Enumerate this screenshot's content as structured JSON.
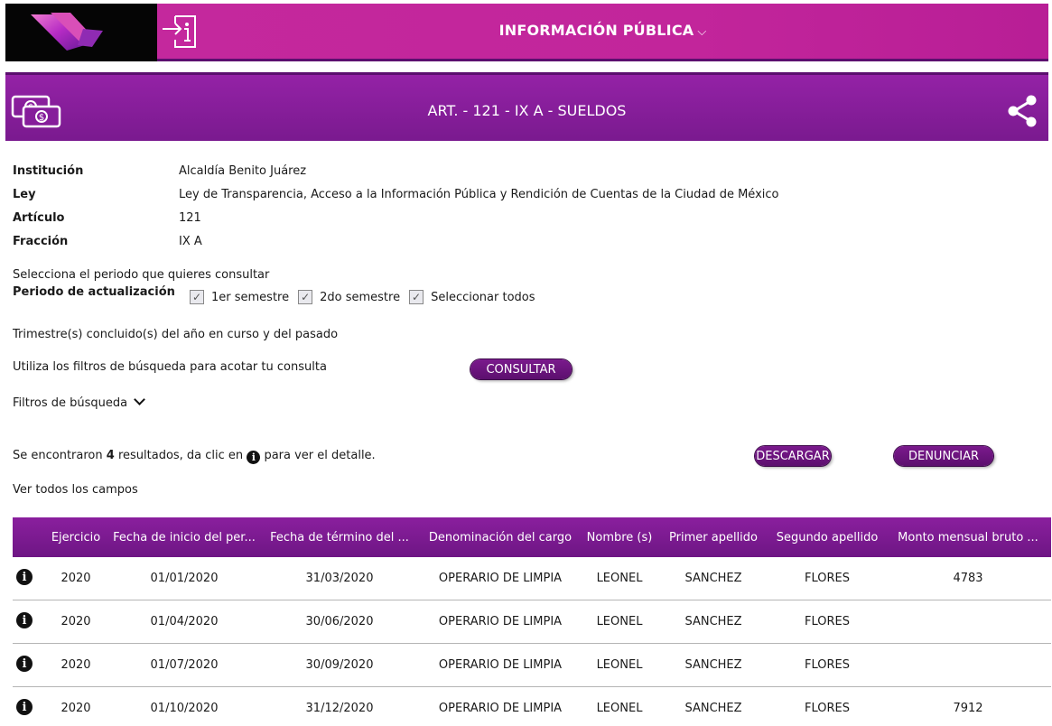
{
  "nav": {
    "title": "INFORMACIÓN PÚBLICA",
    "chevron": "⌵"
  },
  "header": {
    "title": "ART. - 121 - IX A - SUELDOS"
  },
  "info": {
    "rows": [
      {
        "label": "Institución",
        "value": "Alcaldía Benito Juárez"
      },
      {
        "label": "Ley",
        "value": "Ley de Transparencia, Acceso a la Información Pública y Rendición de Cuentas de la Ciudad de México"
      },
      {
        "label": "Artículo",
        "value": "121"
      },
      {
        "label": "Fracción",
        "value": "IX A"
      }
    ]
  },
  "period": {
    "prompt": "Selecciona el periodo que quieres consultar",
    "label": "Periodo de actualización",
    "options": [
      {
        "label": "1er semestre",
        "checked": true
      },
      {
        "label": "2do semestre",
        "checked": true
      },
      {
        "label": "Seleccionar todos",
        "checked": true
      }
    ],
    "check_mark": "✓"
  },
  "trimester_text": "Trimestre(s) concluido(s) del año en curso y del pasado",
  "filters_text": "Utiliza los filtros de búsqueda para acotar tu consulta",
  "consult_button": "CONSULTAR",
  "filters_toggle": "Filtros de búsqueda",
  "filters_chevron": "⌄",
  "results": {
    "prefix": "Se encontraron ",
    "count": "4",
    "middle": " resultados, da clic en ",
    "suffix": " para ver el detalle.",
    "info_glyph": "i"
  },
  "download_button": "DESCARGAR",
  "report_button": "DENUNCIAR",
  "view_all": "Ver todos los campos",
  "table": {
    "columns": [
      "Ejercicio",
      "Fecha de inicio del per...",
      "Fecha de término del ...",
      "Denominación del cargo",
      "Nombre (s)",
      "Primer apellido",
      "Segundo apellido",
      "Monto mensual bruto ..."
    ],
    "rows": [
      [
        "2020",
        "01/01/2020",
        "31/03/2020",
        "OPERARIO DE LIMPIA",
        "LEONEL",
        "SANCHEZ",
        "FLORES",
        "4783"
      ],
      [
        "2020",
        "01/04/2020",
        "30/06/2020",
        "OPERARIO DE LIMPIA",
        "LEONEL",
        "SANCHEZ",
        "FLORES",
        ""
      ],
      [
        "2020",
        "01/07/2020",
        "30/09/2020",
        "OPERARIO DE LIMPIA",
        "LEONEL",
        "SANCHEZ",
        "FLORES",
        ""
      ],
      [
        "2020",
        "01/10/2020",
        "31/12/2020",
        "OPERARIO DE LIMPIA",
        "LEONEL",
        "SANCHEZ",
        "FLORES",
        "7912"
      ]
    ]
  },
  "colors": {
    "pink": "#c4289d",
    "purple": "#8a1f9e",
    "dark_purple": "#5c0f6e"
  }
}
